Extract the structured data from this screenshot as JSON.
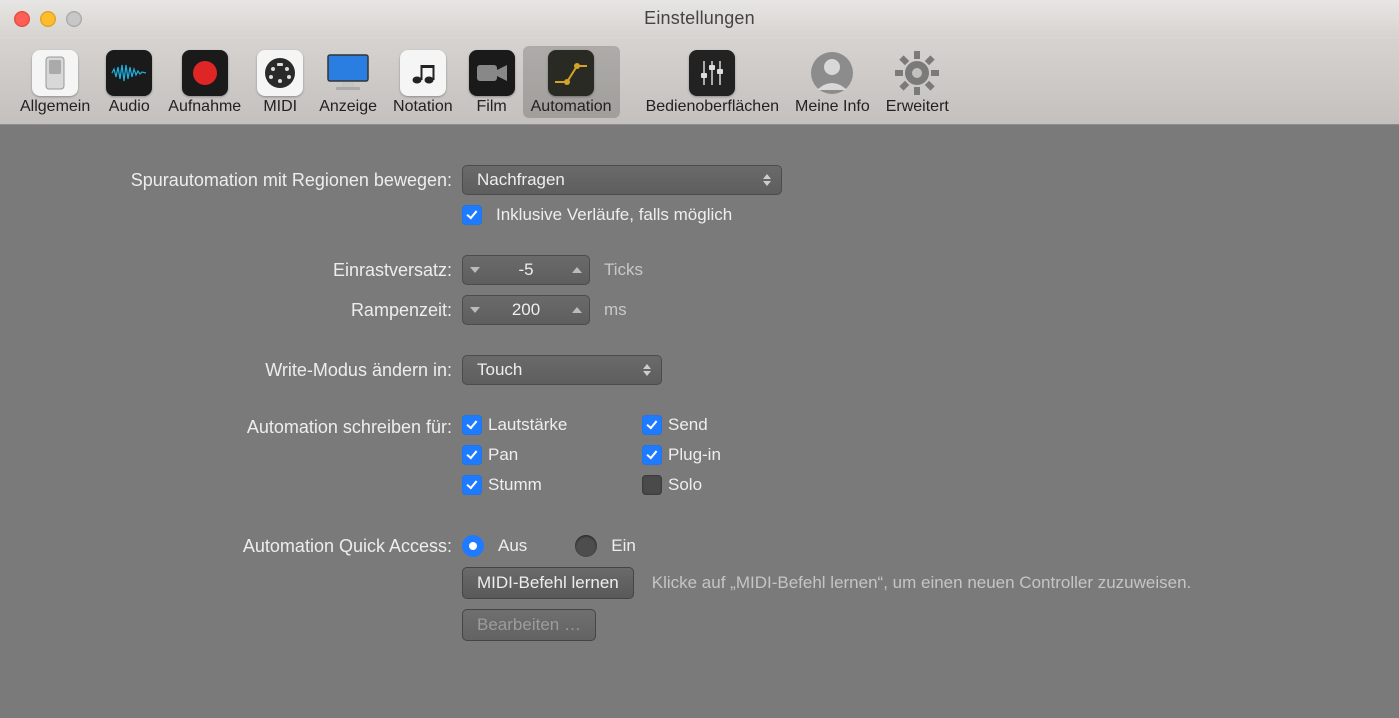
{
  "window": {
    "title": "Einstellungen"
  },
  "toolbar": {
    "general": {
      "label": "Allgemein"
    },
    "audio": {
      "label": "Audio"
    },
    "record": {
      "label": "Aufnahme"
    },
    "midi": {
      "label": "MIDI"
    },
    "display": {
      "label": "Anzeige"
    },
    "notation": {
      "label": "Notation"
    },
    "film": {
      "label": "Film"
    },
    "automation": {
      "label": "Automation"
    },
    "surfaces": {
      "label": "Bedienoberflächen"
    },
    "myinfo": {
      "label": "Meine Info"
    },
    "advanced": {
      "label": "Erweitert"
    }
  },
  "form": {
    "move_automation": {
      "label": "Spurautomation mit Regionen bewegen:",
      "value": "Nachfragen"
    },
    "include_gradients": {
      "label": "Inklusive Verläufe, falls möglich",
      "checked": true
    },
    "snap_offset": {
      "label": "Einrastversatz:",
      "value": "-5",
      "unit": "Ticks"
    },
    "ramp_time": {
      "label": "Rampenzeit:",
      "value": "200",
      "unit": "ms"
    },
    "write_mode": {
      "label": "Write-Modus ändern in:",
      "value": "Touch"
    },
    "write_for": {
      "label": "Automation schreiben für:",
      "volume": {
        "label": "Lautstärke",
        "checked": true
      },
      "pan": {
        "label": "Pan",
        "checked": true
      },
      "mute": {
        "label": "Stumm",
        "checked": true
      },
      "send": {
        "label": "Send",
        "checked": true
      },
      "plugin": {
        "label": "Plug-in",
        "checked": true
      },
      "solo": {
        "label": "Solo",
        "checked": false
      }
    },
    "quick_access": {
      "label": "Automation Quick Access:",
      "off": "Aus",
      "on": "Ein",
      "selected": "off"
    },
    "learn": {
      "button": "MIDI-Befehl lernen",
      "info": "Klicke auf „MIDI-Befehl lernen“, um einen neuen Controller zuzuweisen."
    },
    "edit": {
      "button": "Bearbeiten …"
    }
  }
}
